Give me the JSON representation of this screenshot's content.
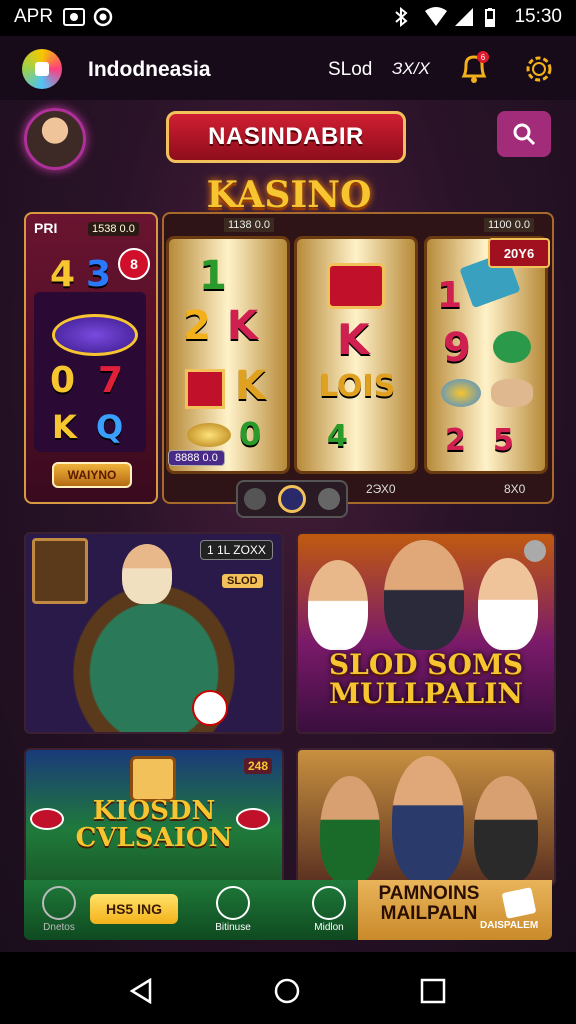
{
  "status_bar": {
    "carrier": "APR",
    "time": "15:30",
    "icons": [
      "photo-icon",
      "record-icon",
      "bluetooth-icon",
      "wifi-icon",
      "signal-icon",
      "battery-icon"
    ]
  },
  "header": {
    "title": "Indodneasia",
    "nav_item_1": "SLod",
    "nav_item_2": "ЗХ/Х",
    "notification_count": "6"
  },
  "hero": {
    "banner": "NASINDABIR",
    "logo_text": "KASINO"
  },
  "left_reel": {
    "label": "PRI",
    "value": "1538 0.0",
    "badge": "8",
    "symbols": [
      "4",
      "3",
      "0",
      "7",
      "K",
      "Q"
    ],
    "button": "WAIYNO"
  },
  "slot": {
    "top_value_1": "1138 0.0",
    "top_value_2": "1100 0.0",
    "jackpot": "20Y6",
    "tag": "8888 0.0",
    "bottom_value_1": "2ЭХ0",
    "bottom_value_2": "8Х0",
    "reel1_symbols": [
      "1",
      "2",
      "K",
      "K",
      "0"
    ],
    "reel2_symbols": [
      "K",
      "K",
      "LOIS",
      "4"
    ],
    "reel3_symbols": [
      "1",
      "9",
      "2",
      "2",
      "5"
    ]
  },
  "cards": {
    "card1_chip": "1 1L ZOXX",
    "card1_badge": "SLOD",
    "card2_title_line1": "SLOD SOMS",
    "card2_title_line2": "MULLPALIN",
    "card3_title_line1": "KIOSDN",
    "card3_title_line2": "CVLSAION",
    "card3_badge": "248"
  },
  "bottom_nav": {
    "home_label": "Dnetos",
    "button_label": "HS5 ING",
    "games_label": "Bitinuse",
    "mobile_label": "Midlon",
    "promo_line1": "PAMNOINS",
    "promo_line2": "MAILPALN",
    "promo_sub": "DAISPALEM"
  },
  "colors": {
    "accent": "#a22c7a",
    "gold": "#f7c530",
    "red": "#d01f32",
    "green": "#1f7a3a"
  }
}
